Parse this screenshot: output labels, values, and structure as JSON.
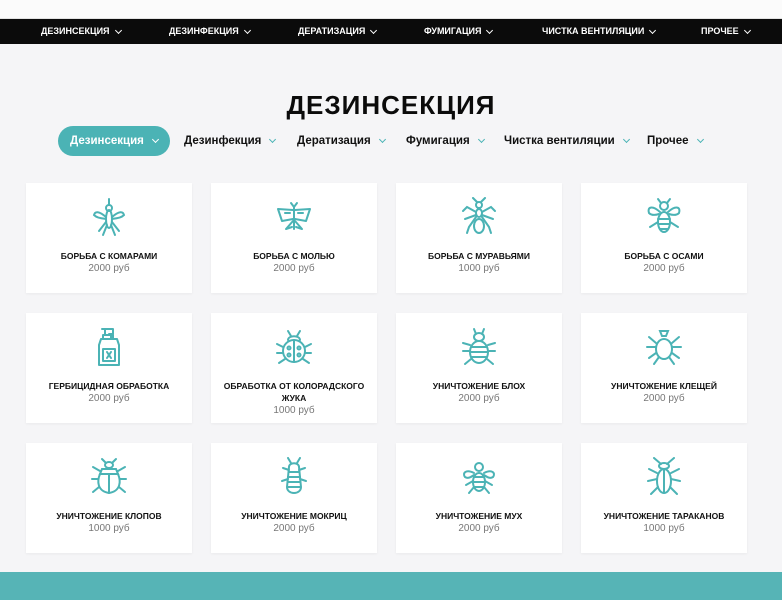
{
  "topnav": [
    {
      "label": "ДЕЗИНСЕКЦИЯ"
    },
    {
      "label": "ДЕЗИНФЕКЦИЯ"
    },
    {
      "label": "ДЕРАТИЗАЦИЯ"
    },
    {
      "label": "ФУМИГАЦИЯ"
    },
    {
      "label": "ЧИСТКА ВЕНТИЛЯЦИИ"
    },
    {
      "label": "ПРОЧЕЕ"
    }
  ],
  "page_title": "ДЕЗИНСЕКЦИЯ",
  "subnav": [
    {
      "label": "Дезинсекция",
      "active": true
    },
    {
      "label": "Дезинфекция"
    },
    {
      "label": "Дератизация"
    },
    {
      "label": "Фумигация"
    },
    {
      "label": "Чистка вентиляции"
    },
    {
      "label": "Прочее"
    }
  ],
  "accent_color": "#4bb3b5",
  "cards": [
    {
      "title": "БОРЬБА С КОМАРАМИ",
      "price": "2000 руб",
      "icon": "mosquito-icon"
    },
    {
      "title": "БОРЬБА С МОЛЬЮ",
      "price": "2000 руб",
      "icon": "moth-icon"
    },
    {
      "title": "БОРЬБА С МУРАВЬЯМИ",
      "price": "1000 руб",
      "icon": "ant-icon"
    },
    {
      "title": "БОРЬБА С ОСАМИ",
      "price": "2000 руб",
      "icon": "wasp-icon"
    },
    {
      "title": "ГЕРБИЦИДНАЯ ОБРАБОТКА",
      "price": "2000 руб",
      "icon": "spray-bottle-icon"
    },
    {
      "title": "ОБРАБОТКА ОТ КОЛОРАДСКОГО ЖУКА",
      "price": "1000 руб",
      "icon": "colorado-beetle-icon"
    },
    {
      "title": "УНИЧТОЖЕНИЕ БЛОХ",
      "price": "2000 руб",
      "icon": "flea-icon"
    },
    {
      "title": "УНИЧТОЖЕНИЕ КЛЕЩЕЙ",
      "price": "2000 руб",
      "icon": "tick-icon"
    },
    {
      "title": "УНИЧТОЖЕНИЕ КЛОПОВ",
      "price": "1000 руб",
      "icon": "bedbug-icon"
    },
    {
      "title": "УНИЧТОЖЕНИЕ МОКРИЦ",
      "price": "2000 руб",
      "icon": "woodlouse-icon"
    },
    {
      "title": "УНИЧТОЖЕНИЕ МУХ",
      "price": "2000 руб",
      "icon": "fly-icon"
    },
    {
      "title": "УНИЧТОЖЕНИЕ ТАРАКАНОВ",
      "price": "1000 руб",
      "icon": "cockroach-icon"
    }
  ]
}
